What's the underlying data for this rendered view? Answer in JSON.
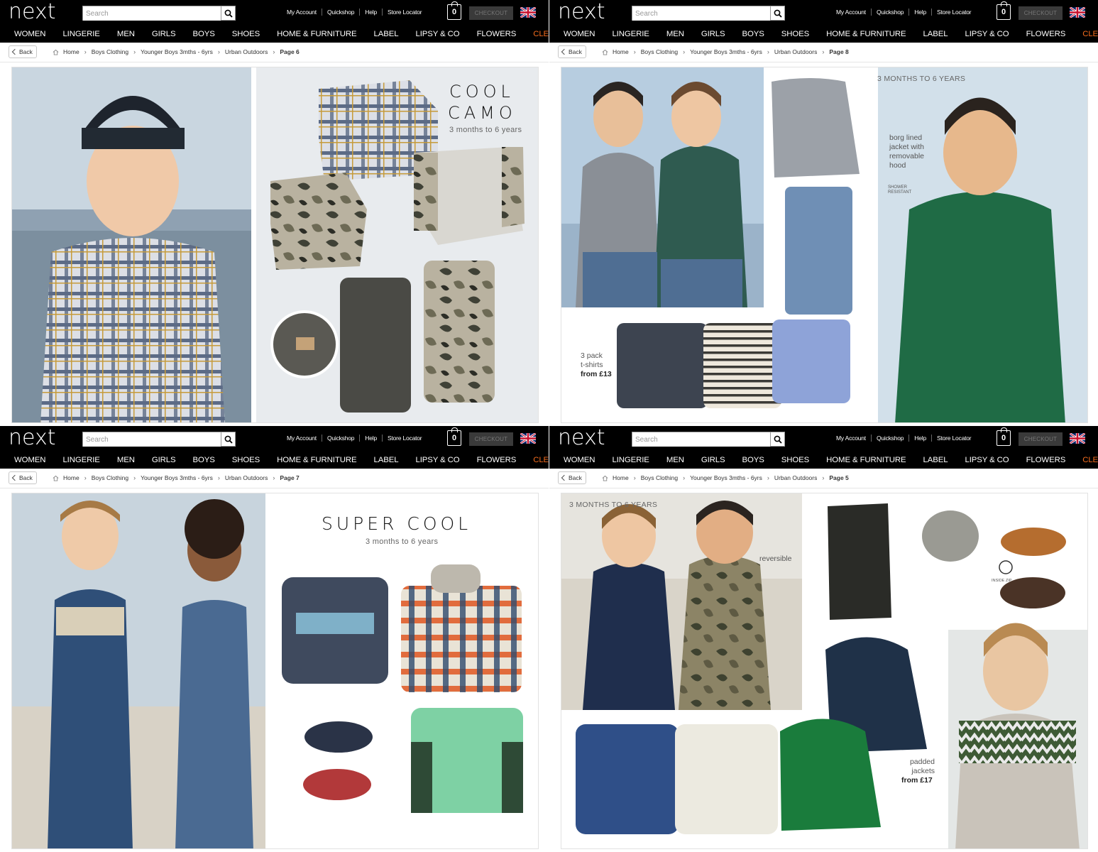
{
  "site": {
    "logo": "next",
    "search_placeholder": "Search",
    "top_links": [
      "My Account",
      "Quickshop",
      "Help",
      "Store Locator"
    ],
    "bag_count": "0",
    "checkout_label": "CHECKOUT",
    "nav": [
      "WOMEN",
      "LINGERIE",
      "MEN",
      "GIRLS",
      "BOYS",
      "SHOES",
      "HOME & FURNITURE",
      "LABEL",
      "LIPSY & CO",
      "FLOWERS",
      "CLEARANCE"
    ],
    "back_label": "Back",
    "crumbs": [
      "Home",
      "Boys Clothing",
      "Younger Boys 3mths - 6yrs",
      "Urban Outdoors"
    ]
  },
  "panels": [
    {
      "page": "Page 6",
      "heading_1": "COOL",
      "heading_2": "CAMO",
      "subheading": "3 months to 6 years"
    },
    {
      "page": "Page 8",
      "age_label": "3 MONTHS TO 6 YEARS",
      "jacket_note": [
        "borg lined",
        "jacket with",
        "removable",
        "hood"
      ],
      "shower_resistant": "SHOWER RESISTANT",
      "tshirt_note": [
        "3 pack",
        "t-shirts"
      ],
      "tshirt_price": "from £13"
    },
    {
      "page": "Page 7",
      "heading": "SUPER COOL",
      "subheading": "3 months to 6 years"
    },
    {
      "page": "Page 5",
      "age_label": "3 MONTHS TO 6 YEARS",
      "reversible": "reversible",
      "inside_zip": "INSIDE ZIP",
      "padded_note": [
        "padded",
        "jackets"
      ],
      "padded_price": "from £17"
    }
  ],
  "colors": {
    "clearance": "#f26b1d",
    "topbar": "#000000",
    "camo_dark": "#3f4136",
    "green_jacket": "#1f6b45",
    "denim": "#3d5a80"
  }
}
